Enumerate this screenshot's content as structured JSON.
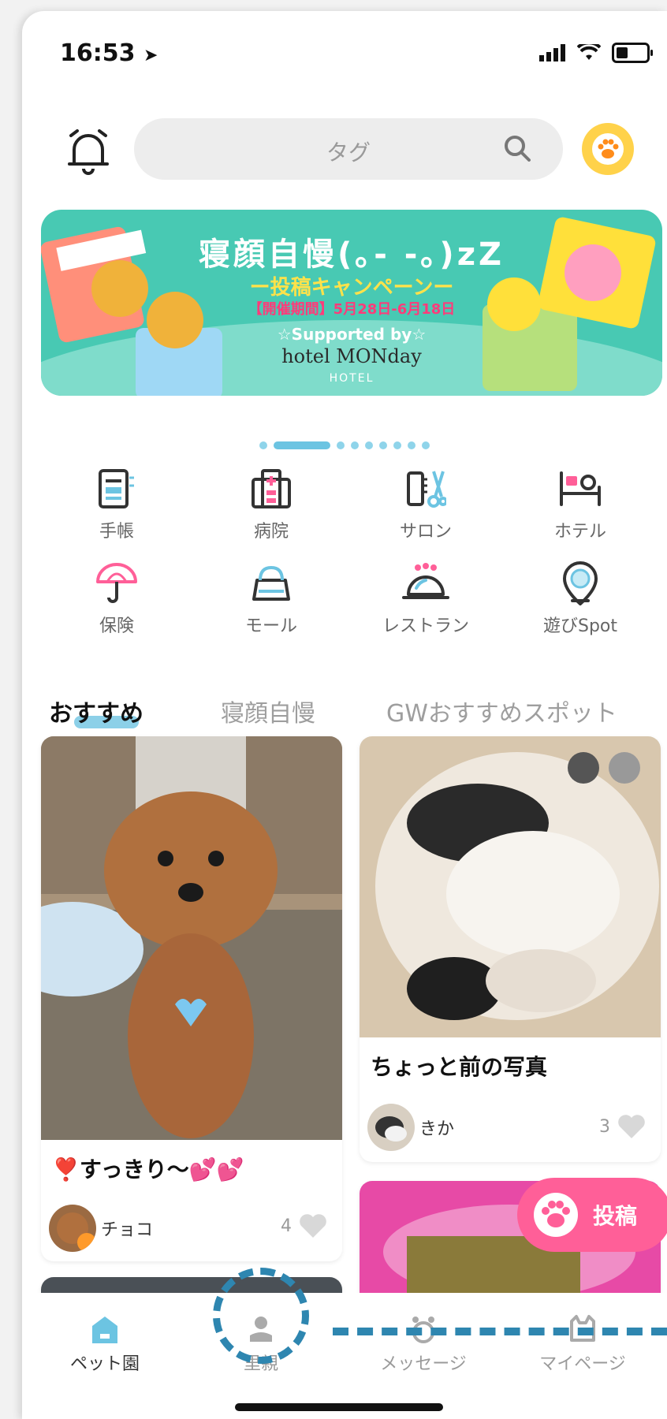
{
  "status_bar": {
    "time": "16:53"
  },
  "header": {
    "search_placeholder": "タグ"
  },
  "banner": {
    "title": "寝顔自慢(｡- -｡)zZ",
    "subtitle": "ー投稿キャンペーンー",
    "period": "【開催期間】5月28日-6月18日",
    "supported": "☆Supported by☆",
    "hotel_line": "hotel MONday",
    "hotel_line2": "HOTEL"
  },
  "carousel": {
    "total": 9,
    "active_index": 1
  },
  "categories": [
    {
      "label": "手帳",
      "icon": "notebook-icon"
    },
    {
      "label": "病院",
      "icon": "hospital-icon"
    },
    {
      "label": "サロン",
      "icon": "salon-icon"
    },
    {
      "label": "ホテル",
      "icon": "hotel-bed-icon"
    },
    {
      "label": "保険",
      "icon": "umbrella-icon"
    },
    {
      "label": "モール",
      "icon": "shopping-bag-icon"
    },
    {
      "label": "レストラン",
      "icon": "restaurant-cloche-icon"
    },
    {
      "label": "遊びSpot",
      "icon": "map-pin-icon"
    }
  ],
  "tabs": [
    {
      "label": "おすすめ",
      "active": true
    },
    {
      "label": "寝顔自慢",
      "active": false
    },
    {
      "label": "GWおすすめスポット",
      "active": false
    }
  ],
  "posts": [
    {
      "title": "❣️すっきり〜💕💕",
      "user": "チョコ",
      "likes": "4"
    },
    {
      "title": "ちょっと前の写真",
      "user": "きか",
      "likes": "3"
    }
  ],
  "post_button": {
    "label": "投稿"
  },
  "bottom_nav": [
    {
      "label": "ペット園",
      "icon": "house-icon",
      "active": true
    },
    {
      "label": "里親",
      "icon": "adoption-icon",
      "active": false
    },
    {
      "label": "メッセージ",
      "icon": "message-icon",
      "active": false
    },
    {
      "label": "マイページ",
      "icon": "mypage-cat-icon",
      "active": false
    }
  ],
  "colors": {
    "accent_blue": "#6cc4e2",
    "banner_teal": "#48c9b3",
    "post_pink": "#ff5f98",
    "paw_yellow": "#ffd24a",
    "highlight_blue": "#2e86b0"
  }
}
